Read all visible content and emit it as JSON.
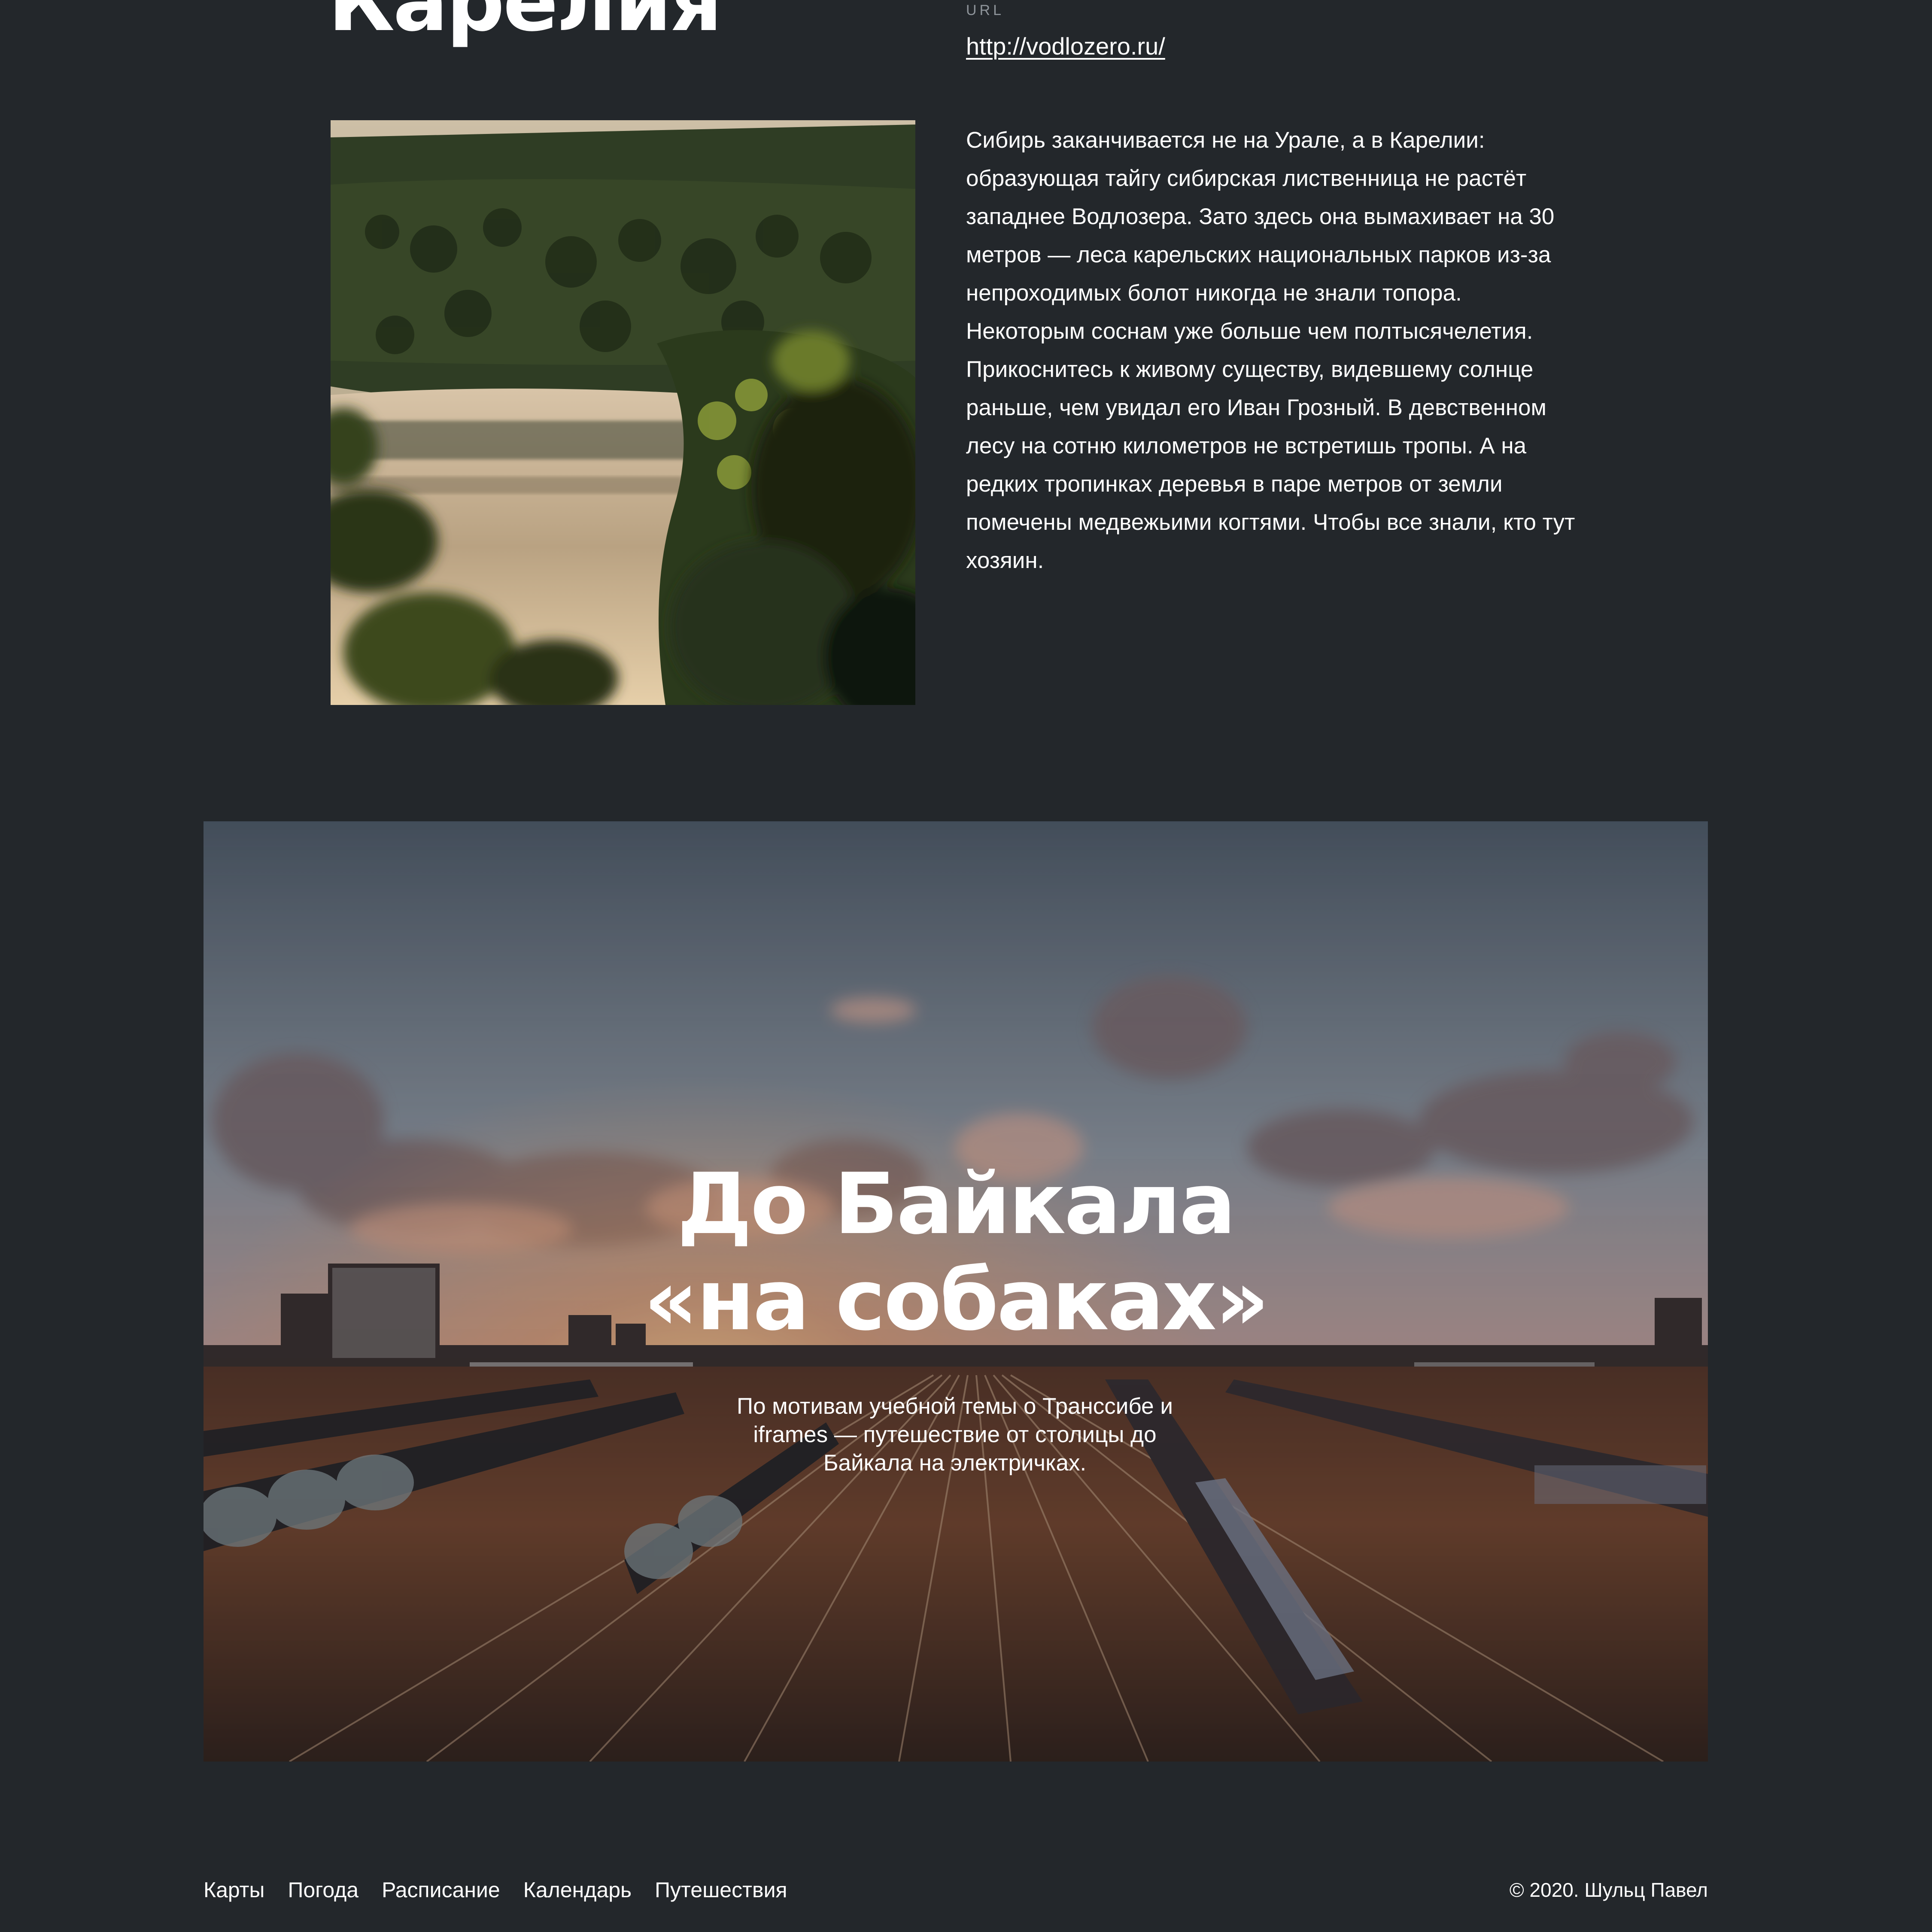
{
  "karelia": {
    "title": "Карелия",
    "url_label": "URL",
    "url": "http://vodlozero.ru/",
    "photo": "karelia-lake-forest-photo",
    "paragraph": "Сибирь заканчивается не на Урале, а в Карелии: образующая тайгу сибирская лиственница не растёт западнее Водлозера. Зато здесь она вымахивает на 30 метров — леса карельских национальных парков из-за непроходимых болот никогда не знали топора. Некоторым соснам уже больше чем полтысячелетия. Прикоснитесь к живому существу, видевшему солнце раньше, чем увидал его Иван Грозный. В девственном лесу на сотню километров не встретишь тропы. А на редких тропинках деревья в паре метров от земли помечены медвежьими когтями. Чтобы все знали, кто тут хозяин."
  },
  "baikal": {
    "photo": "railway-yard-sunset-photo",
    "title_line1": "До Байкала",
    "title_line2": "«на собаках»",
    "subtitle": "По мотивам учебной темы о Транссибе и iframes — путешествие от столицы до Байкала на электричках."
  },
  "footer": {
    "nav": [
      {
        "label": "Карты"
      },
      {
        "label": "Погода"
      },
      {
        "label": "Расписание"
      },
      {
        "label": "Календарь"
      },
      {
        "label": "Путешествия"
      }
    ],
    "copyright": "© 2020. Шульц Павел"
  },
  "colors": {
    "background": "#23272b",
    "text": "#ffffff",
    "muted": "#8e949a"
  }
}
